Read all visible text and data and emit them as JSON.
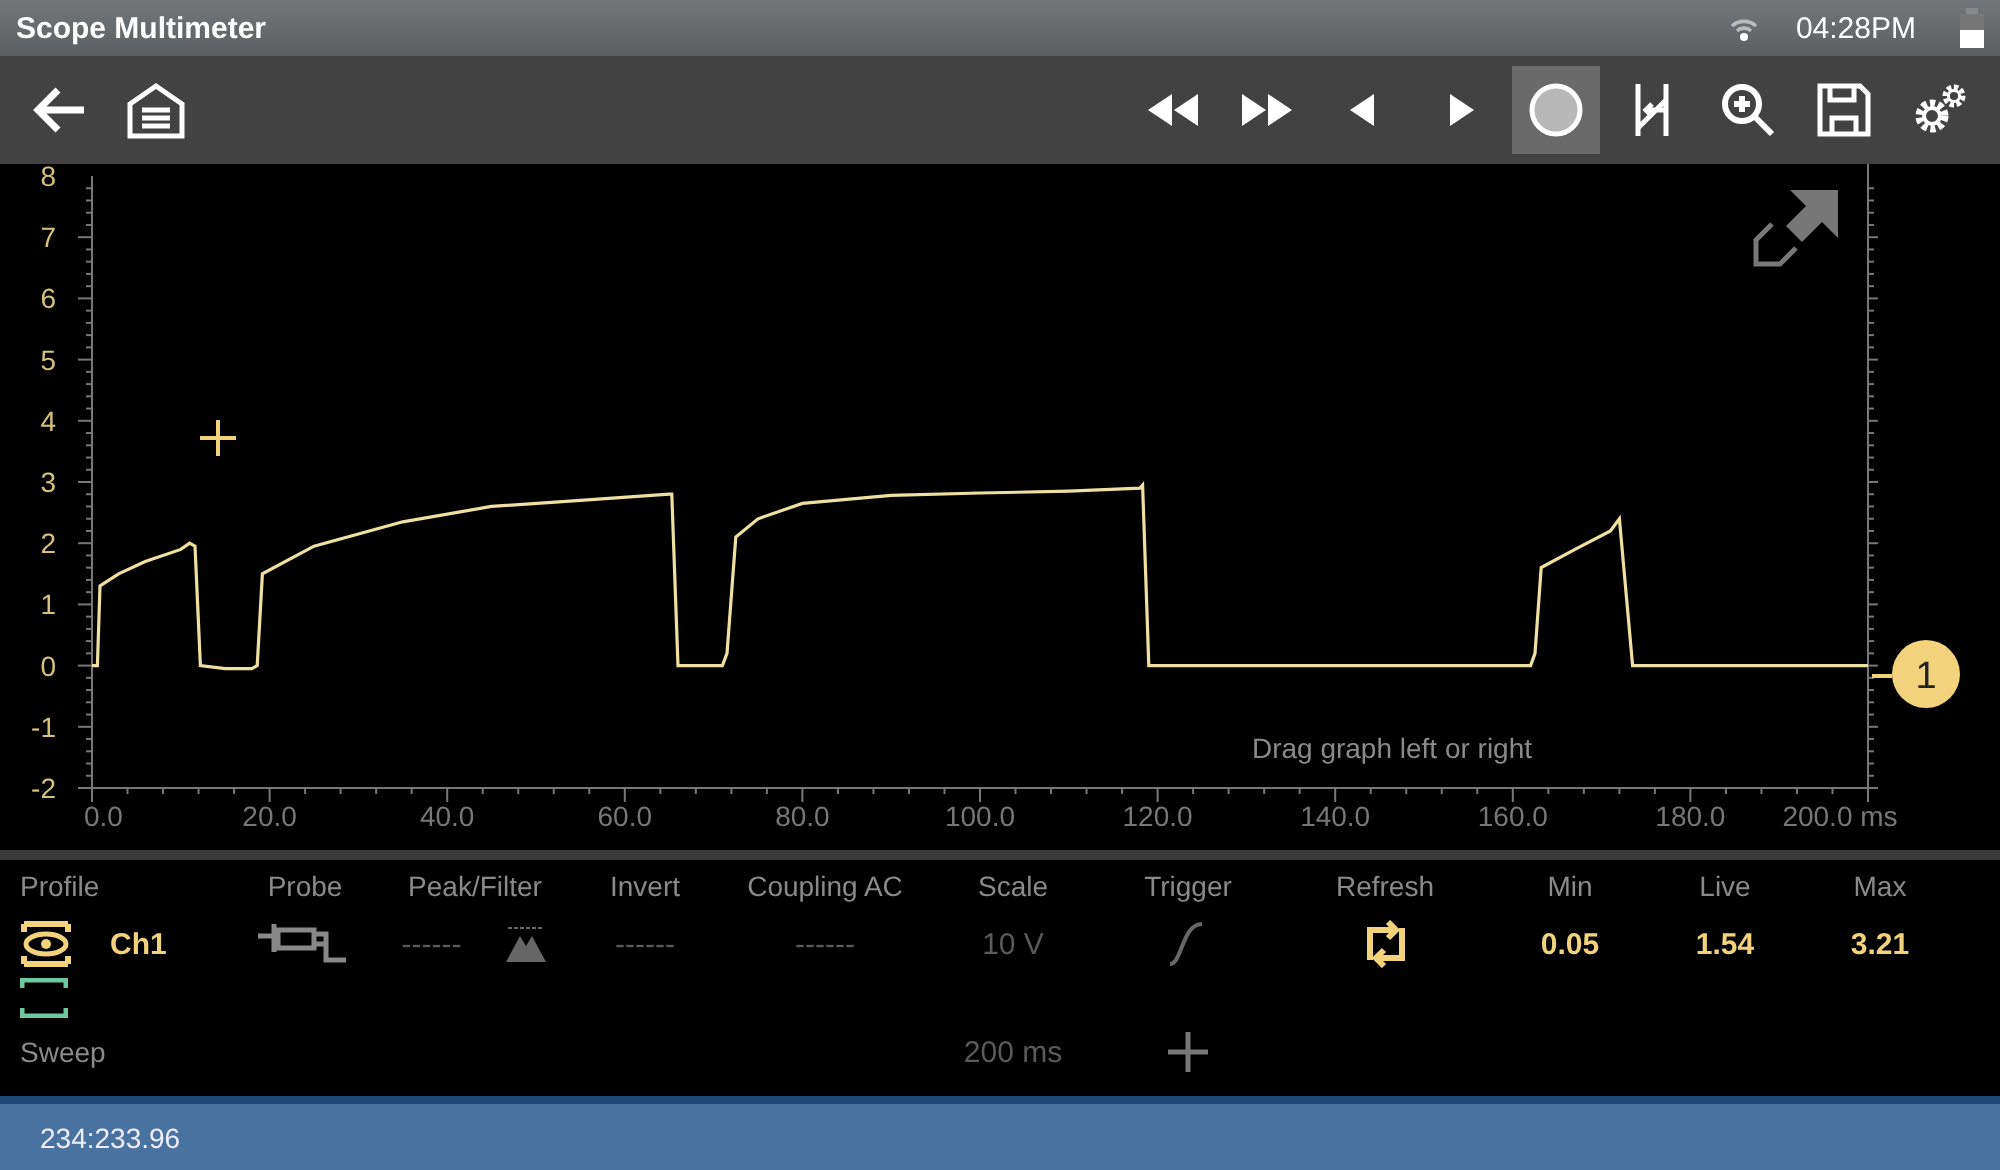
{
  "title_bar": {
    "title": "Scope Multimeter",
    "time": "04:28PM"
  },
  "toolbar": {
    "left": [
      {
        "kind": "back"
      },
      {
        "kind": "home"
      }
    ],
    "right": [
      {
        "kind": "rewind",
        "selected": false
      },
      {
        "kind": "forward",
        "selected": false
      },
      {
        "kind": "step-back",
        "selected": false
      },
      {
        "kind": "step-forward",
        "selected": false
      },
      {
        "kind": "record",
        "selected": true
      },
      {
        "kind": "cursor",
        "selected": false
      },
      {
        "kind": "zoom",
        "selected": false
      },
      {
        "kind": "save",
        "selected": false
      },
      {
        "kind": "settings",
        "selected": false
      }
    ]
  },
  "graph": {
    "hint": "Drag graph left or right",
    "channel_marker": "1",
    "chart_data": {
      "type": "line",
      "xlim": [
        0,
        200
      ],
      "ylim": [
        -2,
        8
      ],
      "xticks": [
        {
          "value": 0,
          "label": "0.0"
        },
        {
          "value": 20,
          "label": "20.0"
        },
        {
          "value": 40,
          "label": "40.0"
        },
        {
          "value": 60,
          "label": "60.0"
        },
        {
          "value": 80,
          "label": "80.0"
        },
        {
          "value": 100,
          "label": "100.0"
        },
        {
          "value": 120,
          "label": "120.0"
        },
        {
          "value": 140,
          "label": "140.0"
        },
        {
          "value": 160,
          "label": "160.0"
        },
        {
          "value": 180,
          "label": "180.0"
        },
        {
          "value": 200,
          "label": "200.0 ms"
        }
      ],
      "yticks": [
        -2,
        -1,
        0,
        1,
        2,
        3,
        4,
        5,
        6,
        7,
        8
      ],
      "x": [
        0,
        0.6,
        0.9,
        3,
        6,
        10,
        11,
        11.6,
        12.2,
        15,
        18,
        18.6,
        19.2,
        25,
        35,
        45,
        55,
        65,
        65.3,
        66,
        71,
        71.5,
        72.5,
        75,
        80,
        90,
        100,
        110,
        118,
        118.3,
        119,
        130,
        150,
        162,
        162.5,
        163.2,
        167,
        171,
        172,
        173,
        173.5,
        185,
        200
      ],
      "series": [
        {
          "color": "#f0e0a0",
          "values": [
            0,
            0,
            1.3,
            1.5,
            1.7,
            1.9,
            2.0,
            1.95,
            0,
            -0.05,
            -0.05,
            0,
            1.5,
            1.95,
            2.35,
            2.6,
            2.7,
            2.8,
            2.8,
            0,
            0,
            0.2,
            2.1,
            2.4,
            2.65,
            2.78,
            2.82,
            2.85,
            2.9,
            2.95,
            0,
            0,
            0,
            0,
            0.2,
            1.6,
            1.9,
            2.2,
            2.4,
            0.8,
            0,
            0,
            0
          ]
        }
      ]
    }
  },
  "settings": {
    "columns": [
      {
        "header": "Profile",
        "kind": "eye"
      },
      {
        "value": "Ch1",
        "disabled": false
      },
      {
        "header": "Probe",
        "kind": "probe"
      },
      {
        "header": "Peak/Filter",
        "value": "------",
        "disabled": true,
        "kind": "peak"
      },
      {
        "header": "Invert",
        "value": "------",
        "disabled": true
      },
      {
        "header": "Coupling AC",
        "value": "------",
        "disabled": true
      },
      {
        "header": "Scale",
        "value": "10 V",
        "disabled": true
      },
      {
        "header": "Trigger",
        "kind": "trigger"
      },
      {
        "header": "Refresh",
        "kind": "refresh"
      },
      {
        "header": "Min",
        "value": "0.05",
        "disabled": false
      },
      {
        "header": "Live",
        "value": "1.54",
        "disabled": false
      },
      {
        "header": "Max",
        "value": "3.21",
        "disabled": false
      }
    ],
    "sweep": {
      "label": "Sweep",
      "value": "200 ms"
    }
  },
  "status_bar": {
    "text": "234:233.96"
  }
}
